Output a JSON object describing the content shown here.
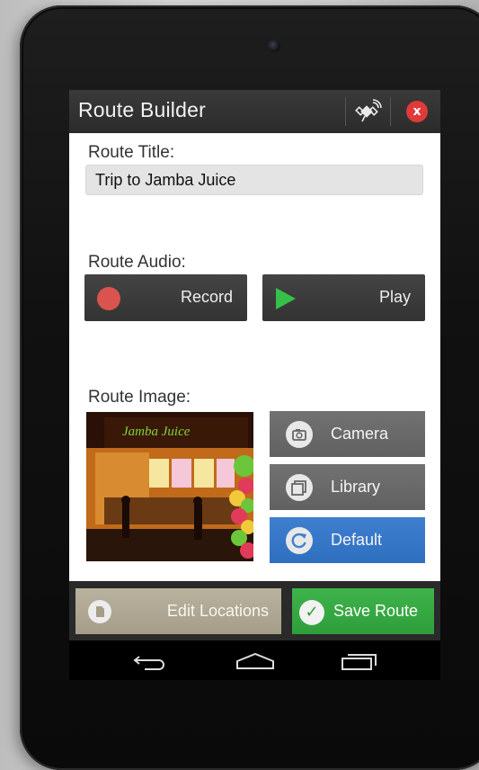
{
  "app": {
    "title": "Route Builder",
    "gps_icon": "satellite-icon",
    "close_glyph": "x"
  },
  "route_title": {
    "label": "Route Title:",
    "value": "Trip to Jamba Juice"
  },
  "route_audio": {
    "label": "Route Audio:",
    "record_label": "Record",
    "play_label": "Play"
  },
  "route_image": {
    "label": "Route Image:",
    "sign_text": "Jamba Juice",
    "camera_label": "Camera",
    "library_label": "Library",
    "default_label": "Default"
  },
  "footer": {
    "edit_label": "Edit Locations",
    "save_label": "Save Route",
    "save_glyph": "✓"
  },
  "colors": {
    "record": "#d9534f",
    "play": "#35c04a",
    "default_button": "#2f6fc0",
    "save_button": "#2e9e3a",
    "edit_button": "#a59d88",
    "close": "#e03a3a"
  }
}
